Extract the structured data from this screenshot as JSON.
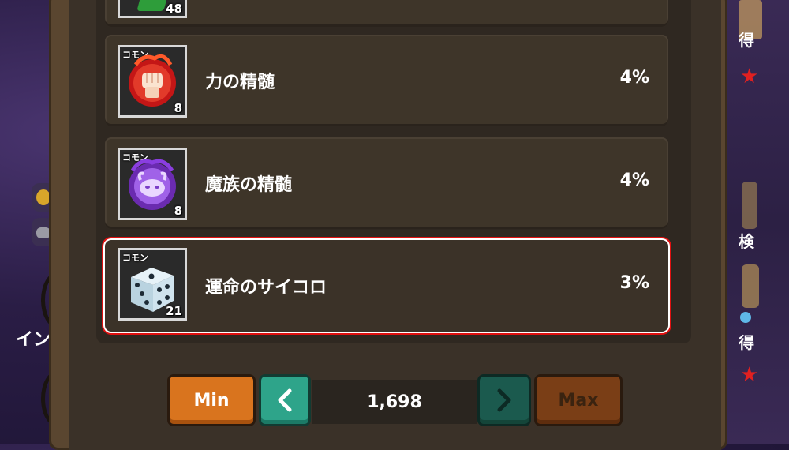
{
  "items": [
    {
      "rarity": "",
      "count": "48",
      "name": "",
      "percent": ""
    },
    {
      "rarity": "コモン",
      "count": "8",
      "name": "力の精髄",
      "percent": "4%"
    },
    {
      "rarity": "コモン",
      "count": "8",
      "name": "魔族の精髄",
      "percent": "4%"
    },
    {
      "rarity": "コモン",
      "count": "21",
      "name": "運命のサイコロ",
      "percent": "3%"
    }
  ],
  "controls": {
    "min_label": "Min",
    "max_label": "Max",
    "quantity": "1,698"
  },
  "background": {
    "left_text": "イン",
    "right_texts": [
      "得",
      "検",
      "得"
    ]
  },
  "colors": {
    "selected_outline": "#e01010",
    "min_button": "#d9741e",
    "arrow_button": "#2ea48a",
    "max_button": "#7a3e16"
  }
}
